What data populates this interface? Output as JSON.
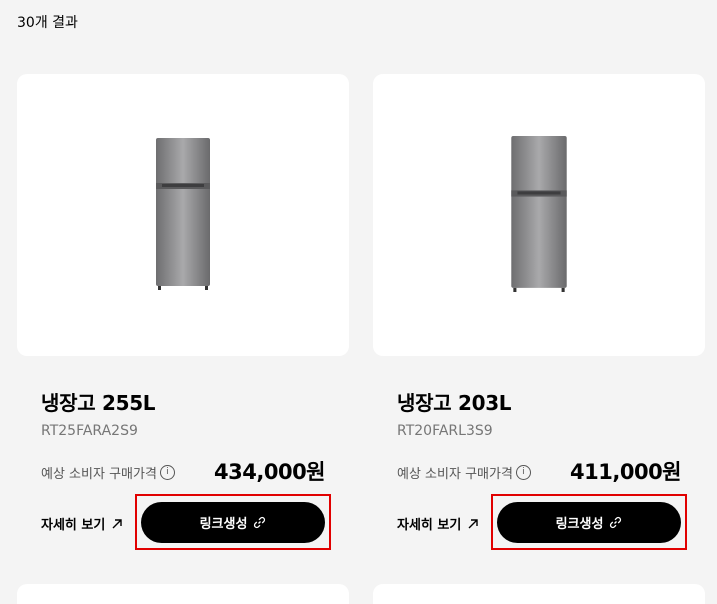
{
  "results": {
    "count_text": "30개 결과"
  },
  "products": [
    {
      "name": "냉장고 255L",
      "model": "RT25FARA2S9",
      "price_label": "예상 소비자 구매가격",
      "info_icon": "info-icon",
      "price": "434,000원",
      "detail_label": "자세히 보기",
      "detail_icon": "arrow-up-right-icon",
      "link_button_label": "링크생성",
      "link_icon": "link-icon",
      "highlighted": true
    },
    {
      "name": "냉장고 203L",
      "model": "RT20FARL3S9",
      "price_label": "예상 소비자 구매가격",
      "info_icon": "info-icon",
      "price": "411,000원",
      "detail_label": "자세히 보기",
      "detail_icon": "arrow-up-right-icon",
      "link_button_label": "링크생성",
      "link_icon": "link-icon",
      "highlighted": true
    }
  ],
  "colors": {
    "background": "#f4f4f4",
    "card": "#ffffff",
    "button": "#000000",
    "highlight": "#e10000",
    "model_text": "#767676"
  }
}
